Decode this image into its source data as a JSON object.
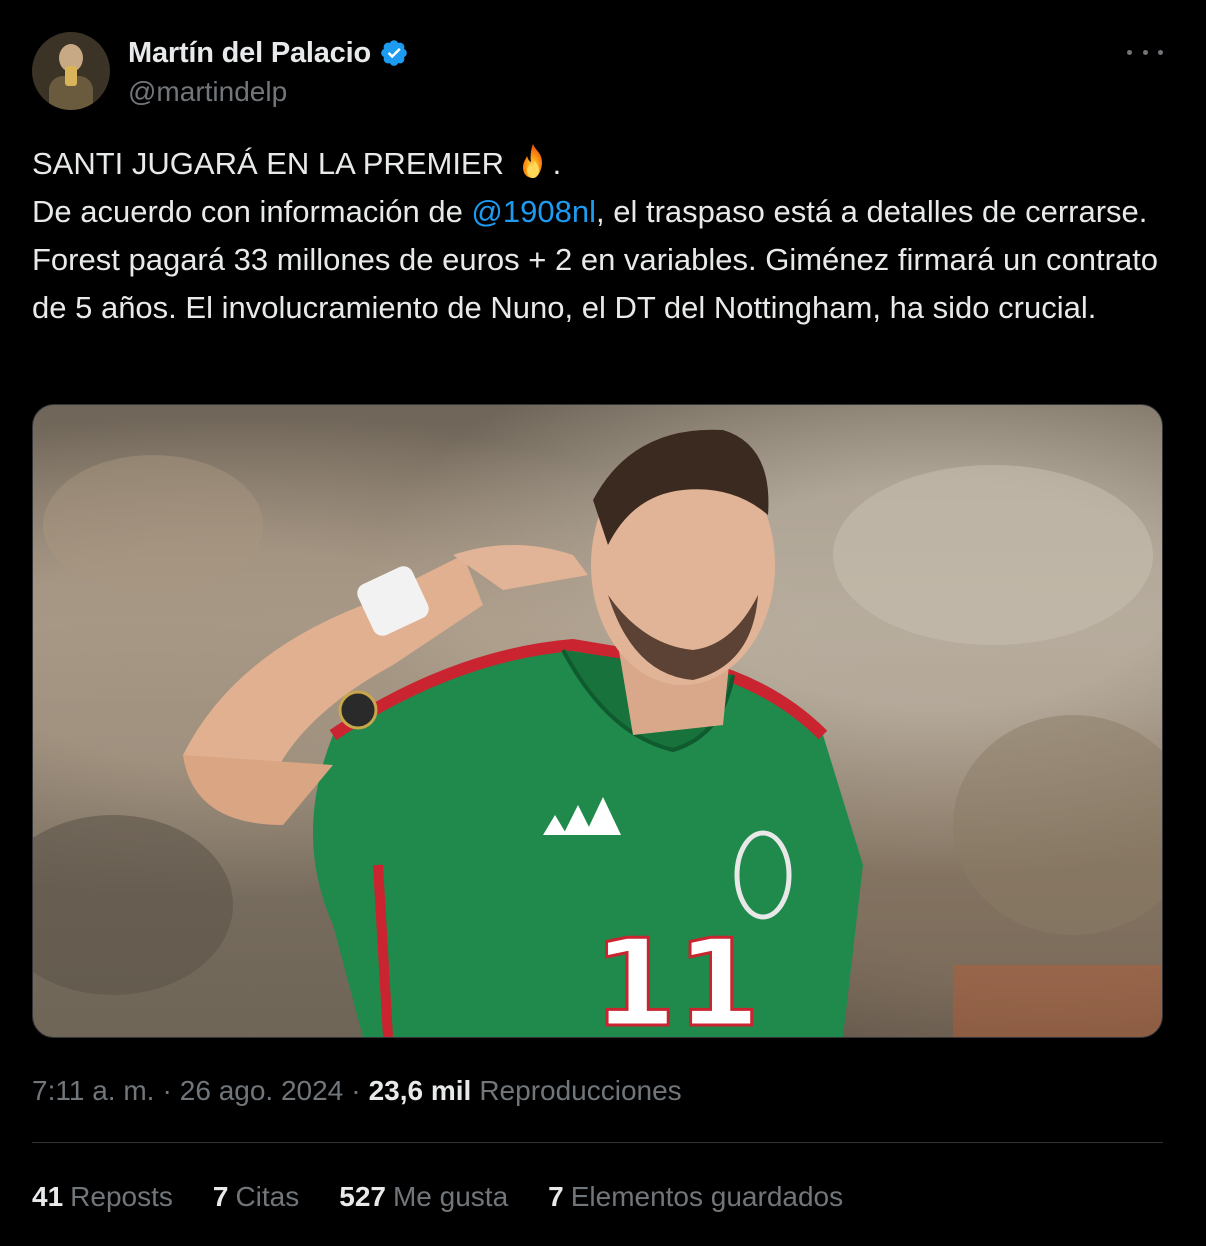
{
  "author": {
    "display_name": "Martín del Palacio",
    "handle": "@martindelp",
    "verified": true,
    "verified_color": "#1d9bf0"
  },
  "tweet": {
    "line1_text": "SANTI JUGARÁ EN LA PREMIER ",
    "line1_emoji": "fire-icon",
    "line1_end": ".",
    "line2_before_mention": "De acuerdo con información de ",
    "mention": "@1908nl",
    "line2_after_mention": ", el traspaso está a detalles de cerrarse. Forest pagará 33 millones de euros + 2 en variables. Giménez firmará un contrato de 5 años. El involucramiento de Nuno, el DT del Nottingham, ha sido crucial.",
    "mention_color": "#1d9bf0"
  },
  "media": {
    "jersey_number": "11"
  },
  "meta": {
    "time": "7:11 a. m.",
    "separator": "·",
    "date": "26 ago. 2024",
    "views_count": "23,6 mil",
    "views_label": "Reproducciones"
  },
  "stats": [
    {
      "count": "41",
      "label": "Reposts"
    },
    {
      "count": "7",
      "label": "Citas"
    },
    {
      "count": "527",
      "label": "Me gusta"
    },
    {
      "count": "7",
      "label": "Elementos guardados"
    }
  ],
  "colors": {
    "background": "#000000",
    "text": "#e7e9ea",
    "secondary_text": "#71767b",
    "divider": "#2f3336"
  }
}
